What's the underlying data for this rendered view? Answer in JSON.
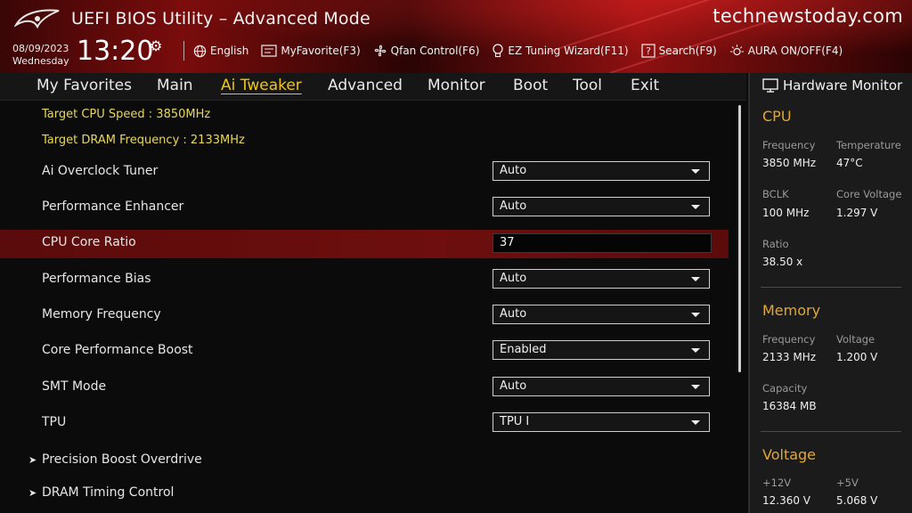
{
  "header": {
    "title": "UEFI BIOS Utility – Advanced Mode",
    "watermark": "technewstoday.com",
    "date": "08/09/2023",
    "weekday": "Wednesday",
    "time": "13:20",
    "toolbar": {
      "language": "English",
      "myfavorite": "MyFavorite(F3)",
      "qfan": "Qfan Control(F6)",
      "ez_tuning": "EZ Tuning Wizard(F11)",
      "search": "Search(F9)",
      "aura": "AURA ON/OFF(F4)"
    }
  },
  "menu": {
    "items": [
      "My Favorites",
      "Main",
      "Ai Tweaker",
      "Advanced",
      "Monitor",
      "Boot",
      "Tool",
      "Exit"
    ],
    "active": "Ai Tweaker"
  },
  "main": {
    "target_cpu": "Target CPU Speed : 3850MHz",
    "target_dram": "Target DRAM Frequency : 2133MHz",
    "settings": [
      {
        "label": "Ai Overclock Tuner",
        "value": "Auto"
      },
      {
        "label": "Performance Enhancer",
        "value": "Auto"
      },
      {
        "label": "CPU Core Ratio",
        "value": "37"
      },
      {
        "label": "Performance Bias",
        "value": "Auto"
      },
      {
        "label": "Memory Frequency",
        "value": "Auto"
      },
      {
        "label": "Core Performance Boost",
        "value": "Enabled"
      },
      {
        "label": "SMT Mode",
        "value": "Auto"
      },
      {
        "label": "TPU",
        "value": "TPU I"
      }
    ],
    "submenus": [
      "Precision Boost Overdrive",
      "DRAM Timing Control"
    ]
  },
  "hardware_monitor": {
    "title": "Hardware Monitor",
    "cpu": {
      "heading": "CPU",
      "frequency_label": "Frequency",
      "frequency": "3850 MHz",
      "temperature_label": "Temperature",
      "temperature": "47°C",
      "bclk_label": "BCLK",
      "bclk": "100 MHz",
      "core_voltage_label": "Core Voltage",
      "core_voltage": "1.297 V",
      "ratio_label": "Ratio",
      "ratio": "38.50 x"
    },
    "memory": {
      "heading": "Memory",
      "frequency_label": "Frequency",
      "frequency": "2133 MHz",
      "voltage_label": "Voltage",
      "voltage": "1.200 V",
      "capacity_label": "Capacity",
      "capacity": "16384 MB"
    },
    "voltage": {
      "heading": "Voltage",
      "v12_label": "+12V",
      "v12": "12.360 V",
      "v5_label": "+5V",
      "v5": "5.068 V"
    }
  },
  "colors": {
    "accent_yellow": "#f0c419",
    "section_orange": "#e3a72f",
    "highlight_red": "#6e0e0e"
  }
}
